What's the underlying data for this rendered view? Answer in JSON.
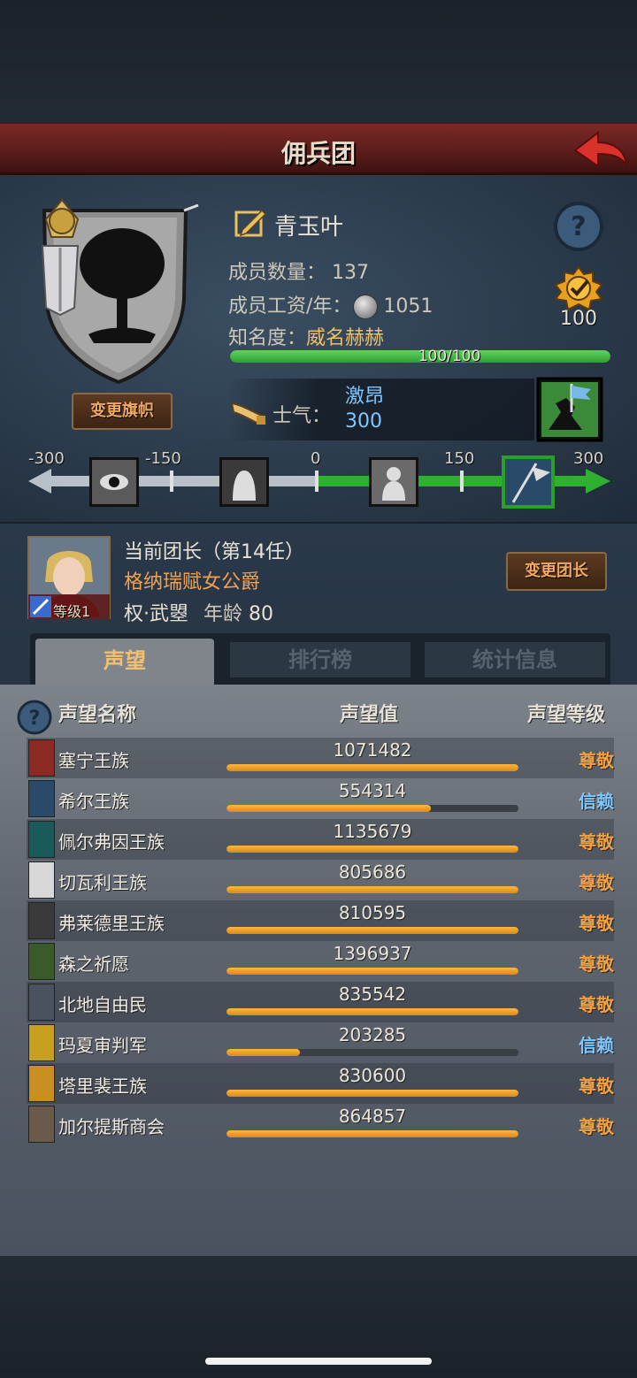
{
  "header": {
    "title": "佣兵团"
  },
  "guild": {
    "name": "青玉叶",
    "change_flag": "变更旗帜",
    "members_label": "成员数量：",
    "members": "137",
    "wage_label": "成员工资/年：",
    "wage": "1051",
    "fame_label": "知名度：",
    "fame_value": "威名赫赫",
    "fame_progress_text": "100/100",
    "fame_progress": 1.0,
    "badge_value": "100",
    "morale_label": "士气：",
    "morale_state": "激昂",
    "morale_value": "300"
  },
  "morale_scale": {
    "ticks": [
      "-300",
      "-150",
      "0",
      "150",
      "300"
    ],
    "current": 300
  },
  "leader": {
    "title": "当前团长（第14任）",
    "name": "格纳瑞赋女公爵",
    "trait": "权·武曌",
    "age_label": "年龄",
    "age": "80",
    "level": "等级1",
    "change_button": "变更团长"
  },
  "tabs": [
    {
      "label": "声望",
      "active": true
    },
    {
      "label": "排行榜",
      "active": false
    },
    {
      "label": "统计信息",
      "active": false
    }
  ],
  "reputation": {
    "headers": {
      "name": "声望名称",
      "value": "声望值",
      "level": "声望等级"
    },
    "rows": [
      {
        "name": "塞宁王族",
        "value": "1071482",
        "level": "尊敬",
        "fill": 1.0,
        "emblem": "#8a2a22"
      },
      {
        "name": "希尔王族",
        "value": "554314",
        "level": "信赖",
        "fill": 0.7,
        "emblem": "#2a4a6a"
      },
      {
        "name": "佩尔弗因王族",
        "value": "1135679",
        "level": "尊敬",
        "fill": 1.0,
        "emblem": "#1a5a5a"
      },
      {
        "name": "切瓦利王族",
        "value": "805686",
        "level": "尊敬",
        "fill": 1.0,
        "emblem": "#d8d8d8"
      },
      {
        "name": "弗莱德里王族",
        "value": "810595",
        "level": "尊敬",
        "fill": 1.0,
        "emblem": "#3a3a3a"
      },
      {
        "name": "森之祈愿",
        "value": "1396937",
        "level": "尊敬",
        "fill": 1.0,
        "emblem": "#3a5a2a"
      },
      {
        "name": "北地自由民",
        "value": "835542",
        "level": "尊敬",
        "fill": 1.0,
        "emblem": "#4a5260"
      },
      {
        "name": "玛夏审判军",
        "value": "203285",
        "level": "信赖",
        "fill": 0.25,
        "emblem": "#c8a020"
      },
      {
        "name": "塔里裴王族",
        "value": "830600",
        "level": "尊敬",
        "fill": 1.0,
        "emblem": "#c89020"
      },
      {
        "name": "加尔提斯商会",
        "value": "864857",
        "level": "尊敬",
        "fill": 1.0,
        "emblem": "#6a5a4a"
      }
    ]
  },
  "colors": {
    "respect": "#f2a040",
    "trust": "#7ec8ff",
    "bar": "#f2a030",
    "morale": "#3fb43f"
  }
}
